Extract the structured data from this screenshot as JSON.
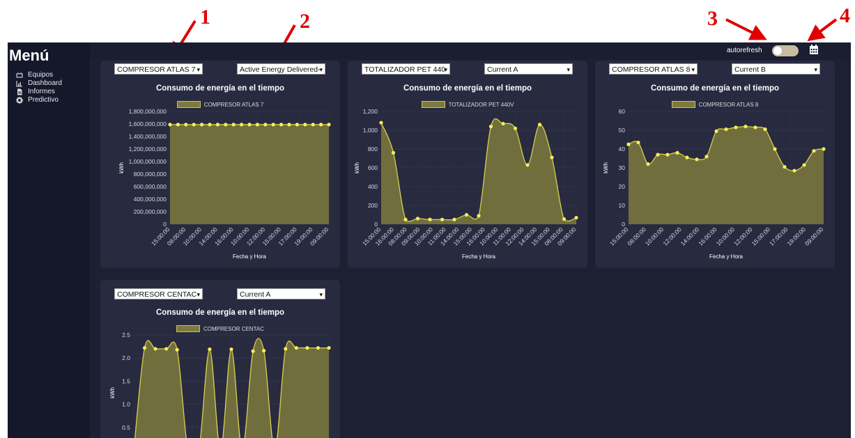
{
  "sidebar": {
    "title": "Menú",
    "items": [
      {
        "label": "Equipos",
        "icon": "plug-icon"
      },
      {
        "label": "Dashboard",
        "icon": "bar-chart-icon"
      },
      {
        "label": "Informes",
        "icon": "document-icon"
      },
      {
        "label": "Predictivo",
        "icon": "gear-icon"
      }
    ]
  },
  "topbar": {
    "autorefresh_label": "autorefresh",
    "autorefresh_on": false
  },
  "annotations": [
    "1",
    "2",
    "3",
    "4"
  ],
  "cards": [
    {
      "device": "COMPRESOR ATLAS 7",
      "metric": "Active Energy Delivered-",
      "title": "Consumo de energía en el tiempo",
      "xlabel": "Fecha y Hora",
      "ylabel": "kWh"
    },
    {
      "device": "TOTALIZADOR PET 440",
      "metric": "Current A",
      "title": "Consumo de energía en el tiempo",
      "xlabel": "Fecha y Hora",
      "ylabel": "kWh"
    },
    {
      "device": "COMPRESOR ATLAS 8",
      "metric": "Current B",
      "title": "Consumo de energía en el tiempo",
      "xlabel": "Fecha y Hora",
      "ylabel": "kWh"
    },
    {
      "device": "COMPRESOR CENTAC",
      "metric": "Current A",
      "title": "Consumo de energía en el tiempo",
      "xlabel": "",
      "ylabel": "kWh"
    }
  ],
  "colors": {
    "fill": "#7e7a3e",
    "line": "#d8d04c",
    "point": "#f3ef5a",
    "background": "#1d1f33",
    "card": "#282a40",
    "annotation": "#e00000"
  },
  "chart_data": [
    {
      "type": "area",
      "title": "Consumo de energía en el tiempo",
      "xlabel": "Fecha y Hora",
      "ylabel": "kWh",
      "x_ticks": [
        "15:00:00",
        "08:00:00",
        "10:00:00",
        "14:00:00",
        "16:00:00",
        "10:00:00",
        "12:00:00",
        "15:00:00",
        "17:00:00",
        "19:00:00",
        "09:00:00"
      ],
      "ylim": [
        0,
        1800000000
      ],
      "y_ticks": [
        "0",
        "200,000,000",
        "400,000,000",
        "600,000,000",
        "800,000,000",
        "1,000,000,000",
        "1,200,000,000",
        "1,400,000,000",
        "1,600,000,000",
        "1,800,000,000"
      ],
      "series": [
        {
          "name": "COMPRESOR ATLAS 7",
          "values": [
            1590000000,
            1590000000,
            1590000000,
            1590000000,
            1590000000,
            1590000000,
            1590000000,
            1590000000,
            1590000000,
            1590000000,
            1590000000,
            1590000000,
            1590000000,
            1590000000,
            1590000000,
            1590000000,
            1590000000,
            1590000000,
            1590000000,
            1590000000,
            1590000000
          ]
        }
      ]
    },
    {
      "type": "area",
      "title": "Consumo de energía en el tiempo",
      "xlabel": "Fecha y Hora",
      "ylabel": "kWh",
      "x_ticks": [
        "15:00:00",
        "16:00:00",
        "08:00:00",
        "09:00:00",
        "10:00:00",
        "11:00:00",
        "14:00:00",
        "15:00:00",
        "16:00:00",
        "10:00:00",
        "11:00:00",
        "12:00:00",
        "14:00:00",
        "15:00:00",
        "08:00:00",
        "09:00:00"
      ],
      "ylim": [
        0,
        1200
      ],
      "y_ticks": [
        "0",
        "200",
        "400",
        "600",
        "800",
        "1,000",
        "1,200"
      ],
      "series": [
        {
          "name": "TOTALIZADOR PET 440V",
          "values": [
            1080,
            760,
            50,
            60,
            50,
            50,
            50,
            100,
            90,
            1040,
            1070,
            1020,
            630,
            1060,
            710,
            55,
            70
          ]
        }
      ]
    },
    {
      "type": "area",
      "title": "Consumo de energía en el tiempo",
      "xlabel": "Fecha y Hora",
      "ylabel": "kWh",
      "x_ticks": [
        "15:00:00",
        "08:00:00",
        "10:00:00",
        "12:00:00",
        "14:00:00",
        "16:00:00",
        "10:00:00",
        "12:00:00",
        "15:00:00",
        "17:00:00",
        "19:00:00",
        "09:00:00"
      ],
      "ylim": [
        0,
        60
      ],
      "y_ticks": [
        "0",
        "10",
        "20",
        "30",
        "40",
        "50",
        "60"
      ],
      "series": [
        {
          "name": "COMPRESOR ATLAS 8",
          "values": [
            42.5,
            43.5,
            32,
            37,
            37,
            38,
            35.5,
            34.5,
            36,
            49.5,
            50.5,
            51.5,
            52,
            51.5,
            50.5,
            40,
            30.5,
            28.5,
            31.5,
            39,
            40
          ]
        }
      ]
    },
    {
      "type": "area",
      "title": "Consumo de energía en el tiempo",
      "xlabel": "",
      "ylabel": "kWh",
      "x_ticks": [],
      "ylim": [
        0,
        2.5
      ],
      "y_ticks": [
        "0.5",
        "1.0",
        "1.5",
        "2.0",
        "2.5"
      ],
      "series": [
        {
          "name": "COMPRESOR CENTAC",
          "values": [
            0,
            2.22,
            2.2,
            2.2,
            2.18,
            0,
            0,
            2.19,
            0,
            2.19,
            0,
            2.15,
            2.16,
            0,
            2.2,
            2.22,
            2.22,
            2.22,
            2.22
          ]
        }
      ]
    }
  ]
}
